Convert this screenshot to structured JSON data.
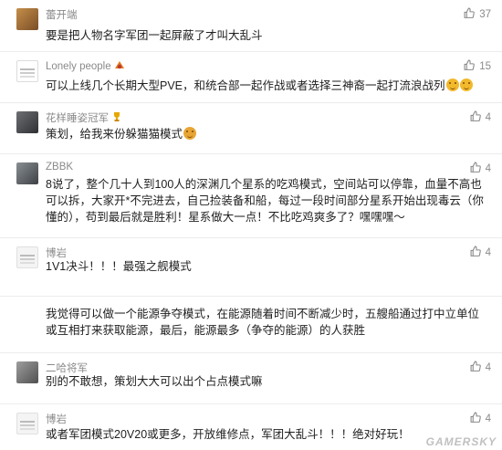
{
  "comments": [
    {
      "nickname": "蕾开端",
      "likes": "37",
      "text": "要是把人物名字军团一起屏蔽了才叫大乱斗"
    },
    {
      "nickname": "Lonely people",
      "likes": "15",
      "text": "可以上线几个长期大型PVE，和统合部一起作战或者选择三神裔一起打流浪战列"
    },
    {
      "nickname": "花样睡姿冠军",
      "likes": "4",
      "text": "策划，给我来份躲猫猫模式"
    },
    {
      "nickname": "ZBBK",
      "likes": "4",
      "text": "8说了，整个几十人到100人的深渊几个星系的吃鸡模式，空间站可以停靠，血量不高也可以拆，大家开*不完进去，自己捡装备和船，每过一段时间部分星系开始出现毒云（你懂的），苟到最后就是胜利！星系做大一点！不比吃鸡爽多了？嘿嘿嘿～"
    },
    {
      "nickname": "博岩",
      "likes": "4",
      "text": "1V1决斗！！！最强之舰模式"
    },
    {
      "nickname": "",
      "likes": "",
      "text": "我觉得可以做一个能源争夺模式，在能源随着时间不断减少时，五艘船通过打中立单位或互相打来获取能源，最后，能源最多（争夺的能源）的人获胜"
    },
    {
      "nickname": "二哈将军",
      "likes": "4",
      "text": "别的不敢想，策划大大可以出个占点模式嘛"
    },
    {
      "nickname": "博岩",
      "likes": "4",
      "text": "或者军团模式20V20或更多，开放维修点，军团大乱斗！！！绝对好玩！"
    }
  ],
  "watermark": "GAMERSKY",
  "colors": {
    "nickname": "#8a8a8a",
    "text": "#1f1f1f",
    "divider": "#ececec"
  }
}
